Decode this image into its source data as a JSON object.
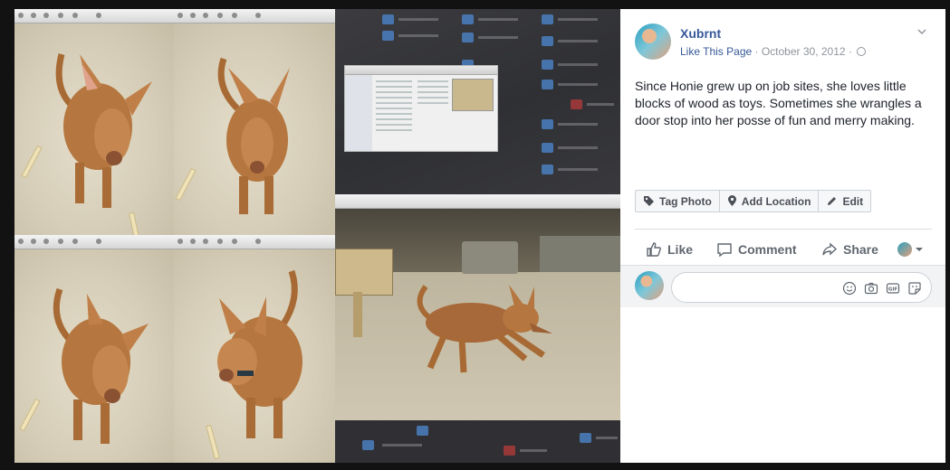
{
  "post": {
    "author": "Xubrnt",
    "like_page": "Like This Page",
    "dot": " · ",
    "date": "October 30, 2012",
    "dot2": " · ",
    "caption": "Since Honie grew up on job sites, she loves little blocks of wood as toys. Sometimes she wrangles a door stop into her posse of fun and merry making."
  },
  "photo_actions": {
    "tag": "Tag Photo",
    "location": "Add Location",
    "edit": "Edit"
  },
  "reactions": {
    "like": "Like",
    "comment": "Comment",
    "share": "Share"
  },
  "comment_box": {
    "placeholder": ""
  },
  "icons": {
    "tag": "tag-icon",
    "location": "map-pin-icon",
    "edit": "pencil-icon",
    "like": "thumbs-up-icon",
    "comment": "speech-bubble-icon",
    "share": "share-arrow-icon",
    "emoji": "smiley-icon",
    "camera": "camera-icon",
    "gif": "gif-icon",
    "sticker": "sticker-icon",
    "privacy": "globe-icon",
    "menu": "chevron-down-icon"
  },
  "colors": {
    "link": "#365899",
    "meta": "#90949c",
    "text": "#1d2129"
  }
}
